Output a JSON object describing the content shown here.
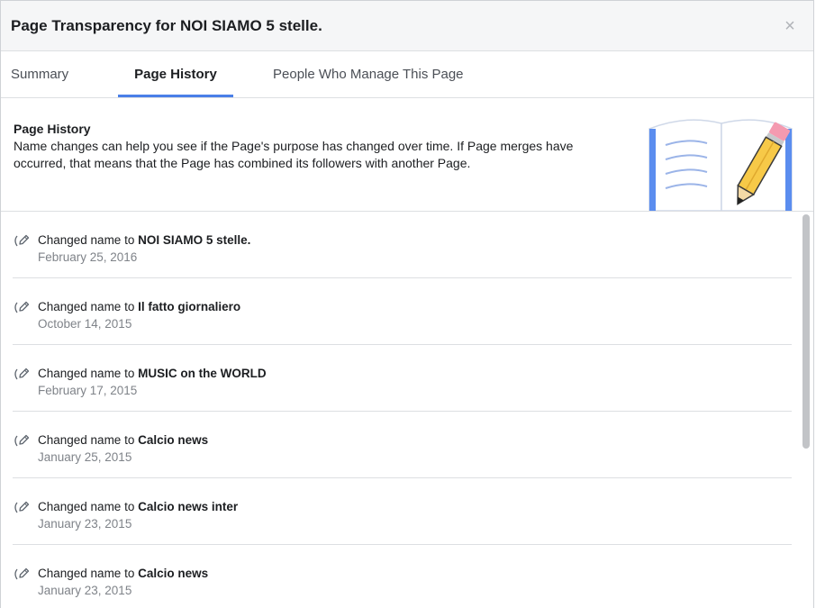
{
  "dialog": {
    "title": "Page Transparency for NOI SIAMO 5 stelle.",
    "close_glyph": "×"
  },
  "tabs": [
    {
      "label": "Summary",
      "active": false
    },
    {
      "label": "Page History",
      "active": true
    },
    {
      "label": "People Who Manage This Page",
      "active": false
    }
  ],
  "intro": {
    "title": "Page History",
    "description": "Name changes can help you see if the Page's purpose has changed over time. If Page merges have occurred, that means that the Page has combined its followers with another Page.",
    "illustration_icon": "book-and-pencil-icon"
  },
  "history": {
    "prefix": "Changed name to",
    "item_icon": "edit-pencil-icon",
    "items": [
      {
        "name": "NOI SIAMO 5 stelle.",
        "date": "February 25, 2016"
      },
      {
        "name": "Il fatto giornaliero",
        "date": "October 14, 2015"
      },
      {
        "name": "MUSIC on the WORLD",
        "date": "February 17, 2015"
      },
      {
        "name": "Calcio news",
        "date": "January 25, 2015"
      },
      {
        "name": "Calcio news inter",
        "date": "January 23, 2015"
      },
      {
        "name": "Calcio news",
        "date": "January 23, 2015"
      }
    ]
  },
  "colors": {
    "tab_active_underline": "#4a7fe8",
    "date_text": "#7f8389",
    "title_bar_bg": "#f5f6f7"
  }
}
